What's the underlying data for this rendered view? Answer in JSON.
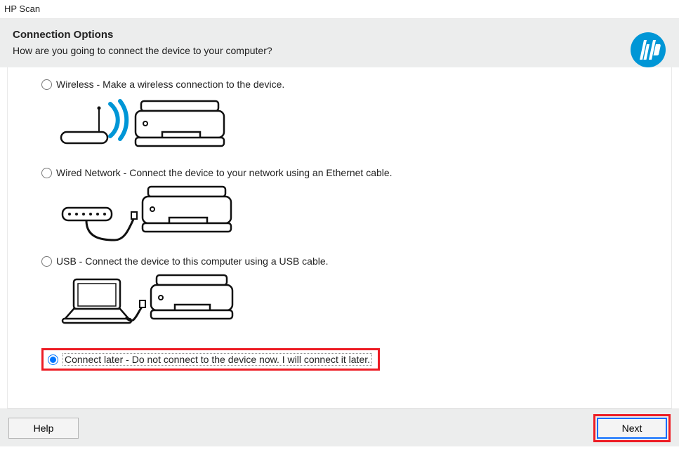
{
  "window_title": "HP Scan",
  "header": {
    "title": "Connection Options",
    "subtitle": "How are you going to connect the device to your computer?"
  },
  "options": {
    "wireless": "Wireless - Make a wireless connection to the device.",
    "wired": "Wired Network - Connect the device to your network using an Ethernet cable.",
    "usb": "USB - Connect the device to this computer using a USB cable.",
    "later": "Connect later - Do not connect to the device now. I will connect it later."
  },
  "buttons": {
    "help": "Help",
    "next": "Next"
  },
  "selected": "later"
}
